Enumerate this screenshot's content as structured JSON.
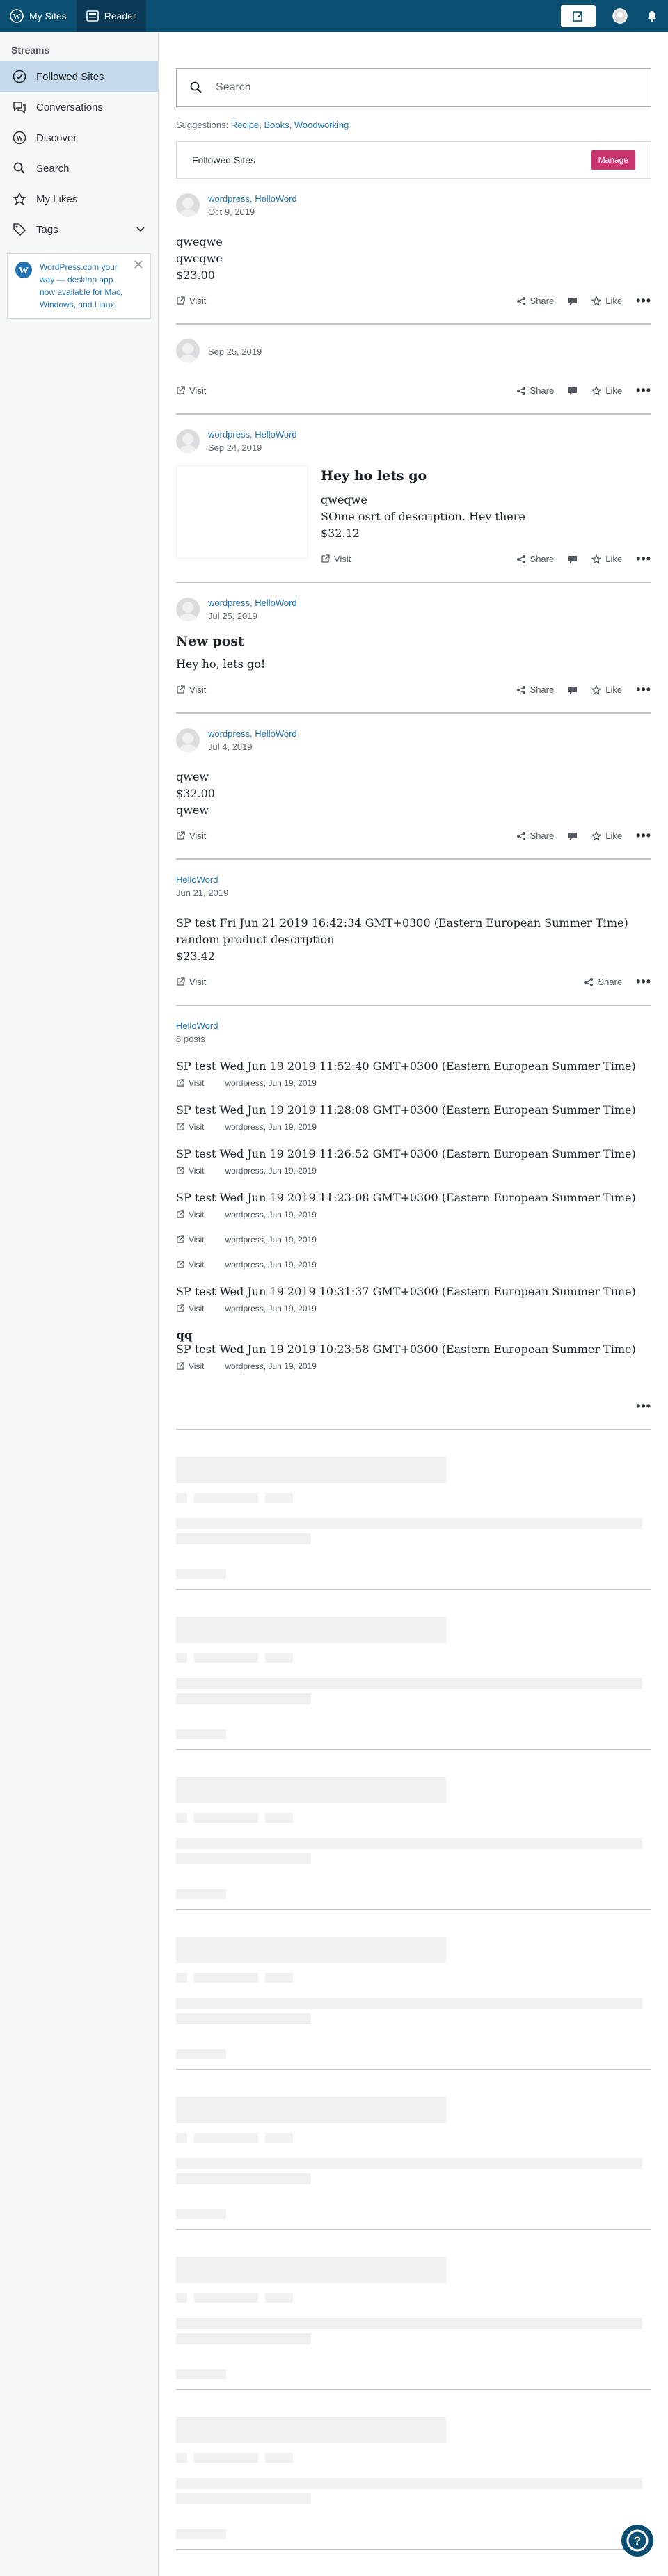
{
  "masterbar": {
    "my_sites": "My Sites",
    "reader": "Reader"
  },
  "sidebar": {
    "heading": "Streams",
    "items": [
      {
        "label": "Followed Sites",
        "icon": "checkmark-circle-icon"
      },
      {
        "label": "Conversations",
        "icon": "chat-icon"
      },
      {
        "label": "Discover",
        "icon": "wordpress-icon"
      },
      {
        "label": "Search",
        "icon": "search-icon"
      },
      {
        "label": "My Likes",
        "icon": "star-icon"
      },
      {
        "label": "Tags",
        "icon": "tag-icon"
      }
    ],
    "notice": "WordPress.com your way — desktop app now available for Mac, Windows, and Linux."
  },
  "search": {
    "placeholder": "Search"
  },
  "suggestions": {
    "label": "Suggestions:",
    "items": [
      "Recipe",
      "Books",
      "Woodworking"
    ]
  },
  "followed_bar": {
    "label": "Followed Sites",
    "manage": "Manage"
  },
  "actions": {
    "visit": "Visit",
    "share": "Share",
    "like": "Like"
  },
  "posts": [
    {
      "site": "wordpress, HelloWord",
      "date": "Oct 9, 2019",
      "lines": [
        "qweqwe",
        "qweqwe",
        "$23.00"
      ]
    },
    {
      "site": "",
      "date": "Sep 25, 2019",
      "lines": []
    },
    {
      "site": "wordpress, HelloWord",
      "date": "Sep 24, 2019",
      "title": "Hey ho lets go",
      "lines": [
        "qweqwe",
        "SOme osrt of description. Hey there",
        "$32.12"
      ]
    },
    {
      "site": "wordpress, HelloWord",
      "date": "Jul 25, 2019",
      "title": "New post",
      "lines": [
        "Hey ho, lets go!"
      ]
    },
    {
      "site": "wordpress, HelloWord",
      "date": "Jul 4, 2019",
      "lines": [
        "qwew",
        "$32.00",
        "qwew"
      ]
    },
    {
      "site": "HelloWord",
      "date": "Jun 21, 2019",
      "lines": [
        "SP test Fri Jun 21 2019 16:42:34 GMT+0300 (Eastern European Summer Time)",
        "random product description",
        "$23.42"
      ]
    }
  ],
  "gallery": {
    "site": "HelloWord",
    "count": "8 posts",
    "items": [
      {
        "title": "SP test Wed Jun 19 2019 11:52:40 GMT+0300 (Eastern European Summer Time)",
        "meta": "wordpress, Jun 19, 2019"
      },
      {
        "title": "SP test Wed Jun 19 2019 11:28:08 GMT+0300 (Eastern European Summer Time)",
        "meta": "wordpress, Jun 19, 2019"
      },
      {
        "title": "SP test Wed Jun 19 2019 11:26:52 GMT+0300 (Eastern European Summer Time)",
        "meta": "wordpress, Jun 19, 2019"
      },
      {
        "title": "SP test Wed Jun 19 2019 11:23:08 GMT+0300 (Eastern European Summer Time)",
        "meta": "wordpress, Jun 19, 2019"
      },
      {
        "title": "",
        "meta": "wordpress, Jun 19, 2019"
      },
      {
        "title": "",
        "meta": "wordpress, Jun 19, 2019"
      },
      {
        "title": "SP test Wed Jun 19 2019 10:31:37 GMT+0300 (Eastern European Summer Time)",
        "meta": "wordpress, Jun 19, 2019"
      },
      {
        "title": "SP test Wed Jun 19 2019 10:23:58 GMT+0300 (Eastern European Summer Time)",
        "heading": "qq",
        "meta": "wordpress, Jun 19, 2019"
      }
    ]
  },
  "colors": {
    "masterbar": "#0b4f73",
    "accent": "#c9356e",
    "link": "#2271b1",
    "selected": "#c5d9ed"
  }
}
